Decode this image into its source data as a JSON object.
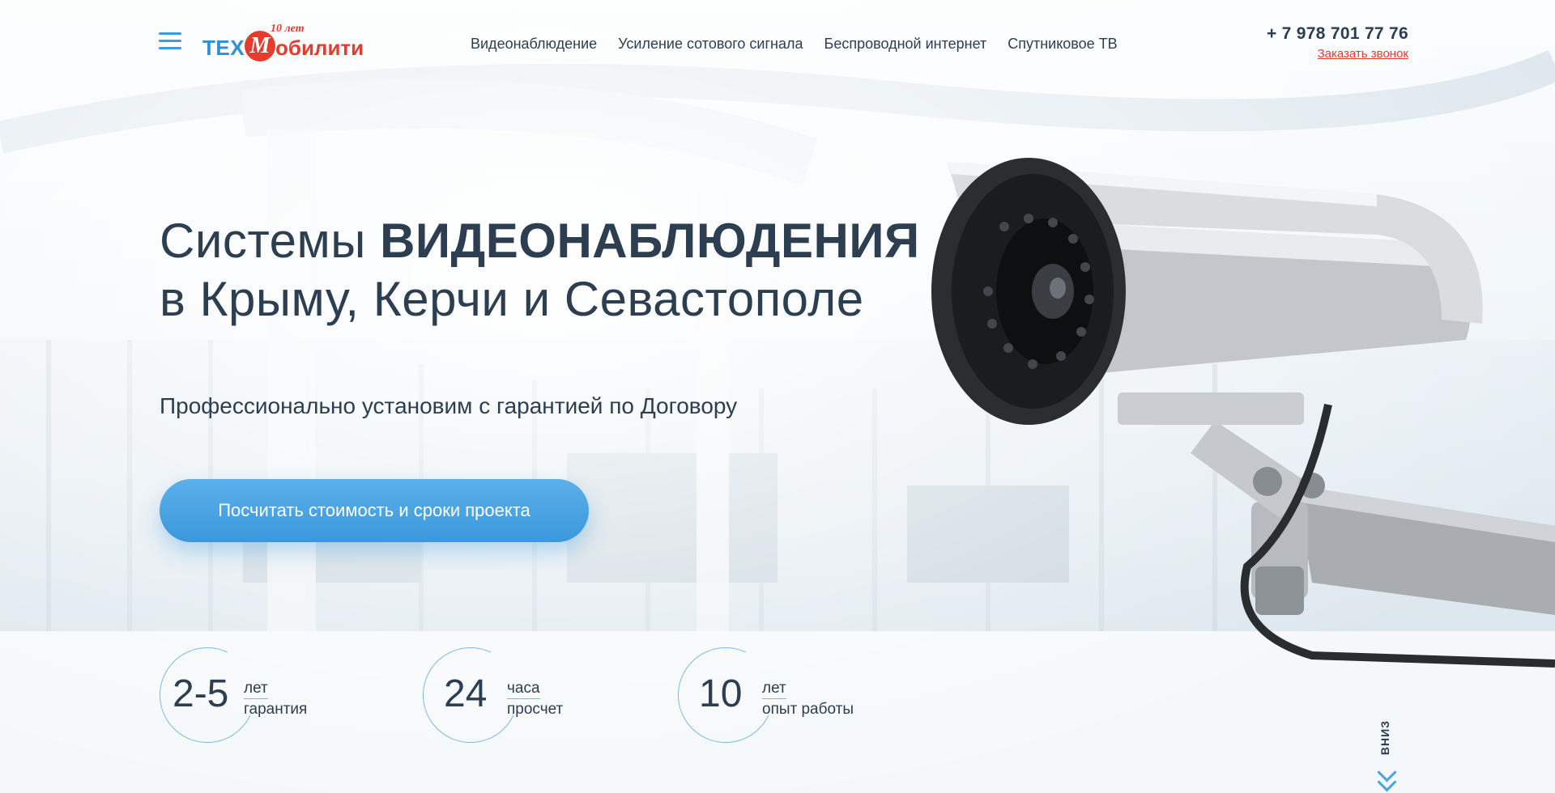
{
  "header": {
    "logo": {
      "part1": "ТЕХ",
      "m": "М",
      "part2": "обилити",
      "badge": "10 лет"
    },
    "nav": [
      "Видеонаблюдение",
      "Усиление сотового сигнала",
      "Беспроводной интернет",
      "Спутниковое ТВ"
    ],
    "phone": "+ 7 978 701 77 76",
    "callback": "Заказать звонок"
  },
  "hero": {
    "title_light": "Системы ",
    "title_bold": "ВИДЕОНАБЛЮДЕНИЯ",
    "title_line2": "в Крыму, Керчи и Севастополе",
    "subtitle": "Профессионально установим с гарантией по Договору",
    "cta": "Посчитать стоимость и сроки проекта"
  },
  "stats": [
    {
      "num": "2-5",
      "top": "лет",
      "bottom": "гарантия"
    },
    {
      "num": "24",
      "top": "часа",
      "bottom": "просчет"
    },
    {
      "num": "10",
      "top": "лет",
      "bottom": "опыт работы"
    }
  ],
  "scroll_down": "ВНИЗ",
  "colors": {
    "accent": "#3d9be0",
    "brand_red": "#e53c2e",
    "text": "#2c3e50"
  }
}
